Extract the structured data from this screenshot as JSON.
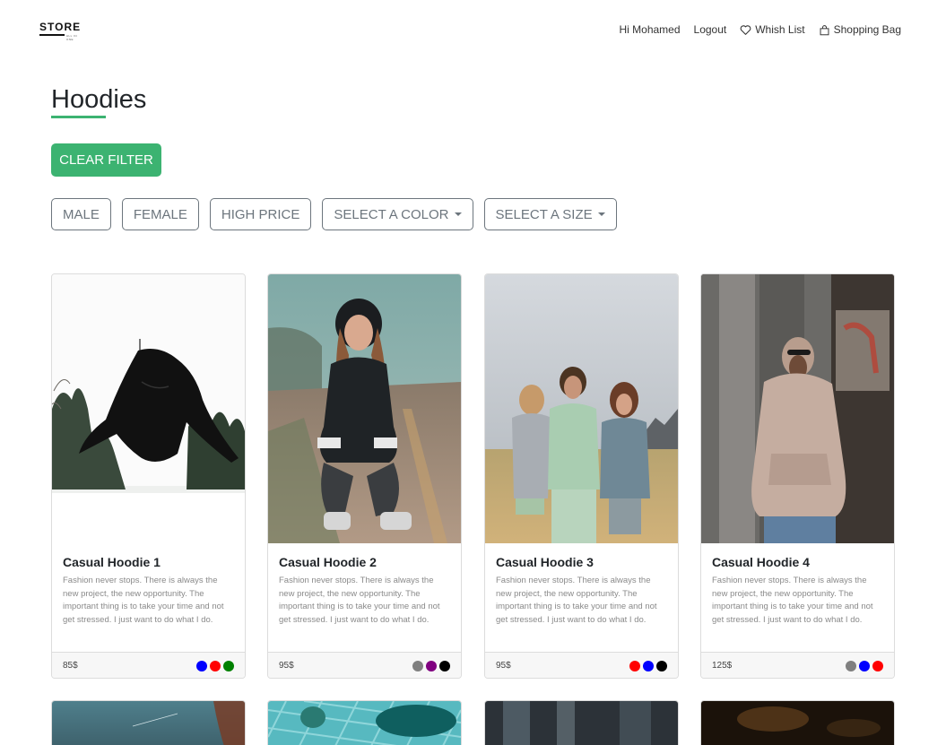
{
  "brand": {
    "logo_text": "STORE",
    "logo_sub": "ALL IN ONE"
  },
  "nav": {
    "greeting": "Hi Mohamed",
    "logout": "Logout",
    "wishlist": "Whish List",
    "bag": "Shopping Bag"
  },
  "page": {
    "title": "Hoodies",
    "clear_filter": "CLEAR FILTER",
    "accent_color": "#3cb371"
  },
  "filters": [
    {
      "label": "MALE",
      "dropdown": false
    },
    {
      "label": "FEMALE",
      "dropdown": false
    },
    {
      "label": "HIGH PRICE",
      "dropdown": false
    },
    {
      "label": "SELECT A COLOR",
      "dropdown": true
    },
    {
      "label": "SELECT A SIZE",
      "dropdown": true
    }
  ],
  "products": [
    {
      "title": "Casual Hoodie 1",
      "description": "Fashion never stops. There is always the new project, the new opportunity. The important thing is to take your time and not get stressed. I just want to do what I do.",
      "price": "85$",
      "colors": [
        "#0000ff",
        "#ff0000",
        "#008000"
      ]
    },
    {
      "title": "Casual Hoodie 2",
      "description": "Fashion never stops. There is always the new project, the new opportunity. The important thing is to take your time and not get stressed. I just want to do what I do.",
      "price": "95$",
      "colors": [
        "#808080",
        "#800080",
        "#000000"
      ]
    },
    {
      "title": "Casual Hoodie 3",
      "description": "Fashion never stops. There is always the new project, the new opportunity. The important thing is to take your time and not get stressed. I just want to do what I do.",
      "price": "95$",
      "colors": [
        "#ff0000",
        "#0000ff",
        "#000000"
      ]
    },
    {
      "title": "Casual Hoodie 4",
      "description": "Fashion never stops. There is always the new project, the new opportunity. The important thing is to take your time and not get stressed. I just want to do what I do.",
      "price": "125$",
      "colors": [
        "#808080",
        "#0000ff",
        "#ff0000"
      ]
    }
  ]
}
